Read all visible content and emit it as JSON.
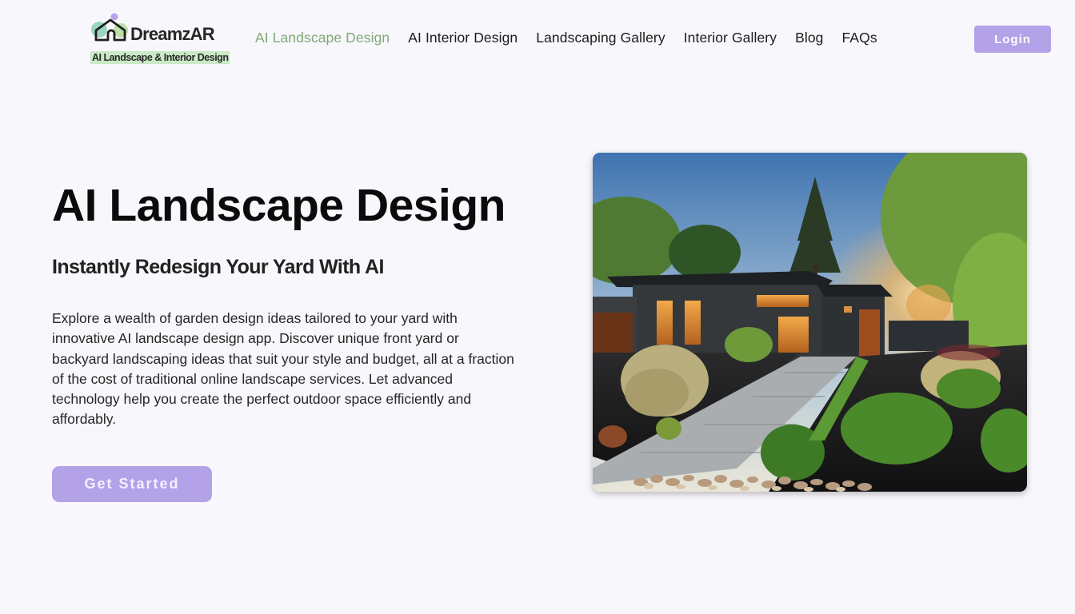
{
  "brand": {
    "name": "DreamzAR",
    "tagline": "AI Landscape & Interior Design",
    "icon": "house-logo-icon"
  },
  "nav": {
    "items": [
      {
        "label": "AI Landscape Design",
        "active": true
      },
      {
        "label": "AI Interior Design",
        "active": false
      },
      {
        "label": "Landscaping Gallery",
        "active": false
      },
      {
        "label": "Interior Gallery",
        "active": false
      },
      {
        "label": "Blog",
        "active": false
      },
      {
        "label": "FAQs",
        "active": false
      }
    ],
    "login_label": "Login"
  },
  "hero": {
    "title": "AI Landscape Design",
    "subtitle": "Instantly Redesign Your Yard With AI",
    "description": "Explore a wealth of garden design ideas tailored to your yard with innovative AI landscape design app. Discover unique front yard or backyard landscaping ideas that suit your style and budget, all at a fraction of the cost of traditional online landscape services. Let advanced technology help you create the perfect outdoor space efficiently and affordably.",
    "cta_label": "Get Started",
    "image_alt": "Modern dark house with landscaped front yard, ornamental grasses, concrete walkway and river rocks at sunset"
  },
  "colors": {
    "background": "#f8f7fc",
    "accent_purple": "#b3a2e8",
    "active_nav_green": "#7fa878",
    "tagline_highlight": "#c9eac4"
  }
}
